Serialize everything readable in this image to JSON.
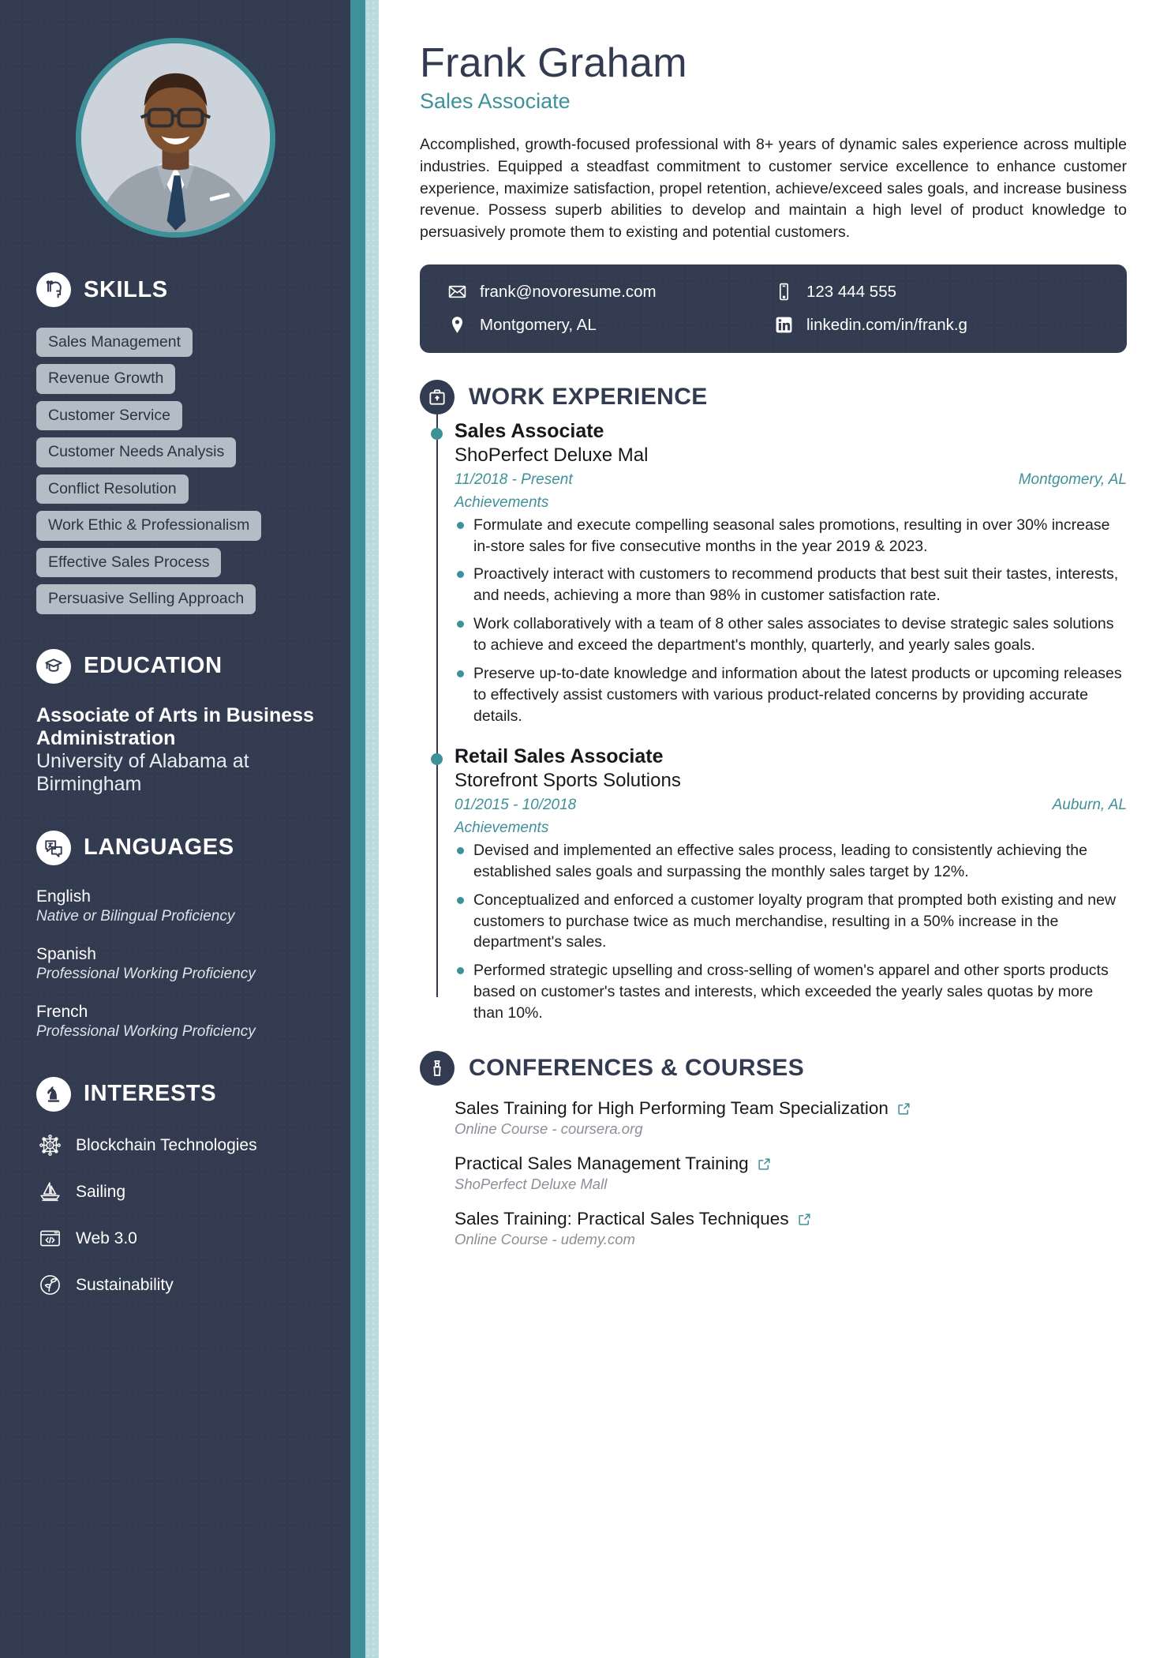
{
  "colors": {
    "sidebar_bg": "#323b50",
    "accent_teal": "#3e9099",
    "strip_light": "#b9dbdd",
    "skill_pill_bg": "#b4bcc6",
    "text_dark": "#16181c",
    "muted": "#8b8f96"
  },
  "header": {
    "name": "Frank Graham",
    "title": "Sales Associate",
    "summary": "Accomplished, growth-focused professional with 8+ years of dynamic sales experience across multiple industries. Equipped a steadfast commitment to customer service excellence to enhance customer experience, maximize satisfaction, propel retention, achieve/exceed sales goals, and increase business revenue. Possess superb abilities to develop and maintain a high level of product knowledge to persuasively promote them to existing and potential customers."
  },
  "contact": {
    "email": "frank@novoresume.com",
    "phone": "123 444 555",
    "location": "Montgomery, AL",
    "linkedin": "linkedin.com/in/frank.g",
    "icons": {
      "email": "envelope-icon",
      "phone": "mobile-phone-icon",
      "location": "map-pin-icon",
      "linkedin": "linkedin-icon"
    }
  },
  "sidebar": {
    "photo_alt": "profile-photo",
    "skills": {
      "heading": "SKILLS",
      "icon": "skills-head-gear-icon",
      "items": [
        "Sales Management",
        "Revenue Growth",
        "Customer Service",
        "Customer Needs Analysis",
        "Conflict Resolution",
        "Work Ethic & Professionalism",
        "Effective Sales Process",
        "Persuasive Selling Approach"
      ]
    },
    "education": {
      "heading": "EDUCATION",
      "icon": "graduation-cap-icon",
      "degree": "Associate of Arts in Business Administration",
      "school": "University of Alabama at Birmingham"
    },
    "languages": {
      "heading": "LANGUAGES",
      "icon": "translate-icon",
      "items": [
        {
          "name": "English",
          "level": "Native or Bilingual Proficiency"
        },
        {
          "name": "Spanish",
          "level": "Professional Working Proficiency"
        },
        {
          "name": "French",
          "level": "Professional Working Proficiency"
        }
      ]
    },
    "interests": {
      "heading": "INTERESTS",
      "icon": "chess-knight-icon",
      "items": [
        {
          "label": "Blockchain Technologies",
          "icon": "blockchain-icon"
        },
        {
          "label": "Sailing",
          "icon": "sailboat-icon"
        },
        {
          "label": "Web 3.0",
          "icon": "code-window-icon"
        },
        {
          "label": "Sustainability",
          "icon": "sustainability-leaf-icon"
        }
      ]
    }
  },
  "work_experience": {
    "heading": "WORK EXPERIENCE",
    "icon": "briefcase-icon",
    "entries": [
      {
        "title": "Sales Associate",
        "company": "ShoPerfect Deluxe Mal",
        "dates": "11/2018 - Present",
        "location": "Montgomery, AL",
        "achievements_label": "Achievements",
        "bullets": [
          "Formulate and execute compelling seasonal sales promotions, resulting in over 30% increase in-store sales for five consecutive months in the year 2019 & 2023.",
          "Proactively interact with customers to recommend products that best suit their tastes, interests, and needs, achieving a more than 98% in customer satisfaction rate.",
          "Work collaboratively with a team of 8 other sales associates to devise strategic sales solutions to achieve and exceed the department's monthly, quarterly, and yearly sales goals.",
          "Preserve up-to-date knowledge and information about the latest products or upcoming releases to effectively assist customers with various product-related concerns by providing accurate details."
        ]
      },
      {
        "title": "Retail Sales Associate",
        "company": "Storefront Sports Solutions",
        "dates": "01/2015 - 10/2018",
        "location": "Auburn, AL",
        "achievements_label": "Achievements",
        "bullets": [
          "Devised and implemented an effective sales process, leading to consistently achieving the established sales goals and surpassing the monthly sales target by 12%.",
          "Conceptualized and enforced a customer loyalty program that prompted both existing and new customers to purchase twice as much merchandise, resulting in a 50% increase in the department's sales.",
          "Performed strategic upselling and cross-selling of women's apparel and other sports products based on customer's tastes and interests, which exceeded the yearly sales quotas by more than 10%."
        ]
      }
    ]
  },
  "conferences": {
    "heading": "CONFERENCES & COURSES",
    "icon": "award-trophy-icon",
    "link_icon": "external-link-icon",
    "items": [
      {
        "title": "Sales Training for High Performing Team Specialization",
        "sub": "Online Course - coursera.org"
      },
      {
        "title": "Practical Sales Management Training",
        "sub": "ShoPerfect Deluxe Mall"
      },
      {
        "title": "Sales Training: Practical Sales Techniques",
        "sub": "Online Course - udemy.com"
      }
    ]
  }
}
